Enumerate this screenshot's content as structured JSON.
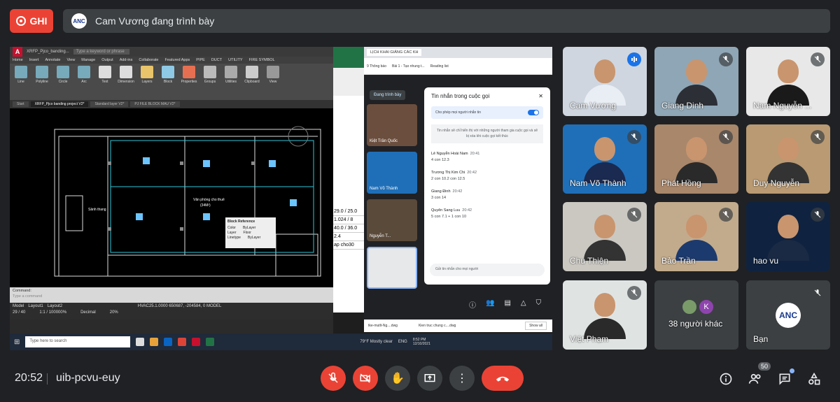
{
  "top": {
    "record_label": "GHI",
    "presenter_text": "Cam Vương đang trình bày",
    "logo_text": "ANC"
  },
  "screen": {
    "acad": {
      "title": "XRFP_Pjco_banding...",
      "search_placeholder": "Type a keyword or phrase",
      "menu": [
        "Home",
        "Insert",
        "Annotate",
        "View",
        "Manage",
        "Output",
        "Add-ins",
        "Collaborate",
        "Featured Apps",
        "PIPE",
        "DUCT",
        "UTILITY",
        "FIRE SYMBOL"
      ],
      "ribbon": [
        "Line",
        "Polyline",
        "Circle",
        "Arc",
        "Text",
        "Dimension",
        "Layers",
        "Block",
        "Properties",
        "Groups",
        "Utilities",
        "Clipboard",
        "View"
      ],
      "tabs": [
        "Start",
        "XRFP_Pjco banding project V2*",
        "Standard layer V2*",
        "PJ FILE BLOCK MAU V2*"
      ],
      "tooltip_title": "Block Reference",
      "tooltip_rows": [
        [
          "Color",
          "ByLayer"
        ],
        [
          "Layer",
          "Floor"
        ],
        [
          "Linetype",
          "ByLayer"
        ]
      ],
      "room_label": "Văn phòng cho thuê",
      "room_area": "(34M²)",
      "room_label2": "Sảnh thang",
      "command_label": "Command:",
      "command_placeholder": "Type a command",
      "status_coords": "HVAC25.1.0000   650687, -204584, 0   MODEL",
      "layout_tabs": [
        "Model",
        "Layout1",
        "Layout2"
      ],
      "scale": "1:1 / 100000%",
      "units": "Decimal",
      "page": "29 / 40",
      "zoom": "20%"
    },
    "excel": {
      "cells": [
        "29.0 / 25.0",
        "1.024 / 8",
        "40.0 / 36.0",
        "2.4",
        "ap cho30"
      ]
    },
    "browser": {
      "tabs": [
        "LỊCH KHAI GIẢNG CÁC KH"
      ],
      "bookmarks": [
        "9 Thông báo",
        "Bài 1 - Tạo nhung t...",
        "Reading list"
      ],
      "present_label": "Đang trình bày",
      "mini_tiles": [
        "Kiệt Trần Quốc",
        "Nam Võ Thành",
        "Nguyễn T...",
        ""
      ],
      "chat": {
        "title": "Tin nhắn trong cuộc gọi",
        "toggle": "Cho phép mọi người nhắn tin",
        "note": "Tin nhắn sẽ chỉ hiển thị với những người tham gia cuộc gọi và sẽ bị xóa khi cuộc gọi kết thúc",
        "messages": [
          {
            "name": "Lê Nguyễn Hoài Nam",
            "time": "20:41",
            "text": "4 con 12.3"
          },
          {
            "name": "Trương Thị Kim Chi",
            "time": "20:42",
            "text": "2 con 10.2 con 12.5"
          },
          {
            "name": "Giang Đinh",
            "time": "20:42",
            "text": "3 con 14"
          },
          {
            "name": "Quyên Sang Luu",
            "time": "20:42",
            "text": "5 con 7.1 + 1 con 10"
          }
        ],
        "input_placeholder": "Gửi tin nhắn cho mọi người"
      },
      "downloads": [
        "tke-mutlt-Ng....dwg",
        "Kien truc chung c....dwg"
      ],
      "show_all": "Show all"
    },
    "taskbar": {
      "search": "Type here to search",
      "weather": "79°F Mostly clear",
      "lang": "ENG",
      "time": "8:52 PM",
      "date": "12/10/2021"
    }
  },
  "tiles": [
    {
      "name": "Cam Vương",
      "shirt": "#e9eef5",
      "bg": "#cfd6df",
      "speaking": true
    },
    {
      "name": "Giang Dinh",
      "shirt": "#2c2f36",
      "bg": "#8fa6b6"
    },
    {
      "name": "Nam Nguyễn ...",
      "shirt": "#1a1a1a",
      "bg": "#e8e8e8"
    },
    {
      "name": "Nam Võ Thành",
      "shirt": "#1b2a50",
      "bg": "#1f6fb8"
    },
    {
      "name": "Phát Hồng",
      "shirt": "#2a2a2a",
      "bg": "#a9876b"
    },
    {
      "name": "Duy Nguyễn",
      "shirt": "#333",
      "bg": "#b99a73"
    },
    {
      "name": "Chu Thiện",
      "shirt": "#333",
      "bg": "#cbc8c2"
    },
    {
      "name": "Bảo Trần",
      "shirt": "#1d3a6e",
      "bg": "#c2ab8c"
    },
    {
      "name": "hao vu",
      "shirt": "#1a2a44",
      "bg": "#0f2340"
    },
    {
      "name": "Việt Phạm",
      "shirt": "#2a2a2a",
      "bg": "#dfe4e3"
    },
    {
      "name": "38 người khác",
      "others_initial": "K"
    },
    {
      "name": "Bạn",
      "logo": "ANC"
    }
  ],
  "bottom": {
    "time": "20:52",
    "meeting_code": "uib-pcvu-euy",
    "participants_count": "50"
  }
}
